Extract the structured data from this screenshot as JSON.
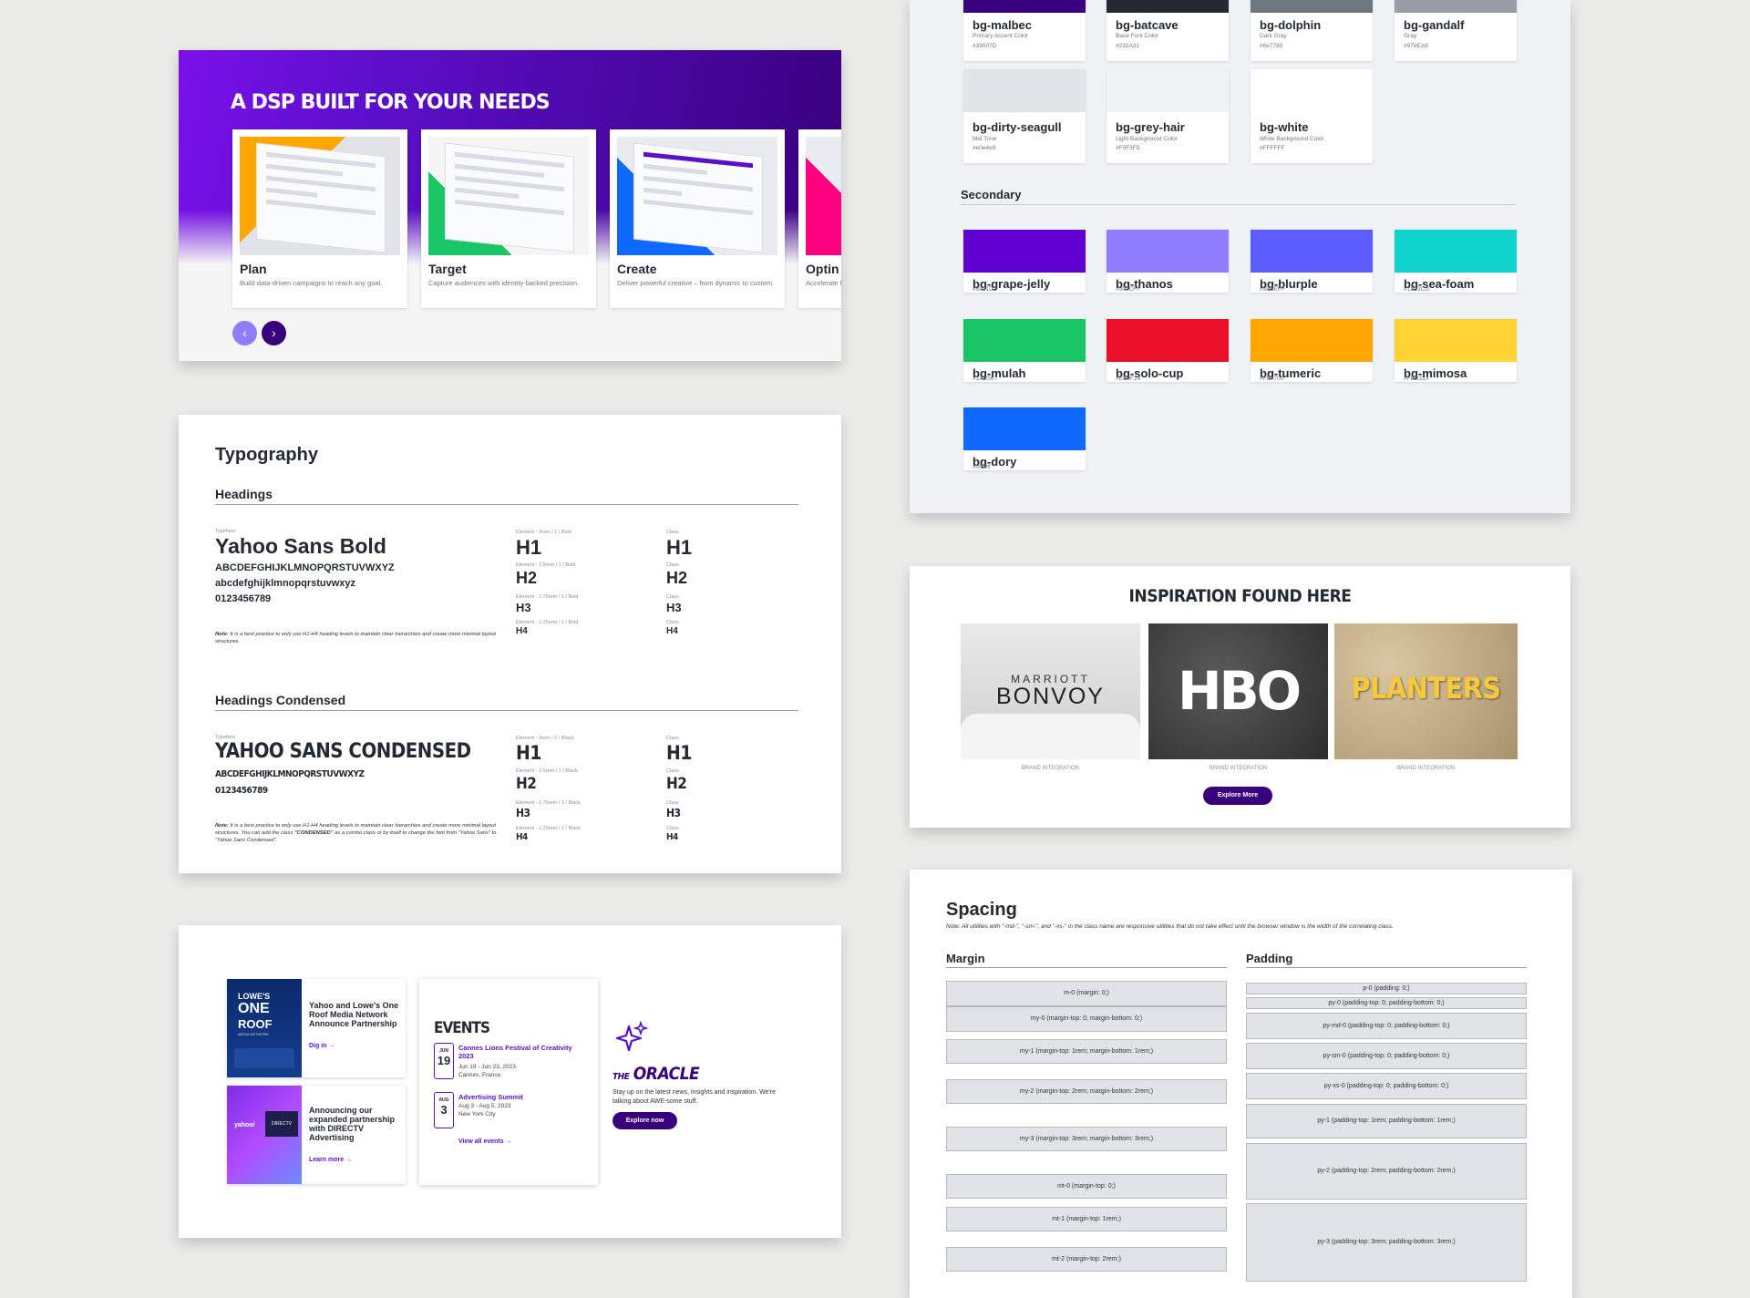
{
  "hero": {
    "title": "A DSP BUILT FOR YOUR NEEDS",
    "cards": [
      {
        "title": "Plan",
        "desc": "Build data-driven campaigns to reach any goal.",
        "accent": "#ffa700"
      },
      {
        "title": "Target",
        "desc": "Capture audiences with identity-backed precision.",
        "accent": "#1ac567"
      },
      {
        "title": "Create",
        "desc": "Deliver powerful creative – from dynamic to custom.",
        "accent": "#0f69ff"
      },
      {
        "title": "Optin",
        "desc": "Accelerate learning te",
        "accent": "#ff0080"
      }
    ],
    "prev_icon": "chevron-left-icon",
    "next_icon": "chevron-right-icon"
  },
  "typography": {
    "title": "Typography",
    "headings_label": "Headings",
    "typeface_label": "Typeface",
    "typeface_name": "Yahoo Sans Bold",
    "upper": "ABCDEFGHIJKLMNOPQRSTUVWXYZ",
    "lower": "abcdefghijklmnopqrstuvwxyz",
    "digits": "0123456789",
    "note_label": "Note:",
    "note": "It is a best practice to only use H1-H4 heading levels to maintain clear hierarchies and create more minimal layout structures.",
    "class_label": "Class",
    "elements": [
      {
        "meta": "Element - 3rem / 1 / Bold",
        "tag": "H1"
      },
      {
        "meta": "Element - 2.5rem / 1 / Bold",
        "tag": "H2"
      },
      {
        "meta": "Element - 1.75rem / 1 / Bold",
        "tag": "H3"
      },
      {
        "meta": "Element - 1.25rem / 1 / Bold",
        "tag": "H4"
      }
    ],
    "condensed_label": "Headings Condensed",
    "condensed_name": "YAHOO SANS CONDENSED",
    "condensed_upper": "ABCDEFGHIJKLMNOPQRSTUVWXYZ",
    "condensed_digits": "0123456789",
    "condensed_note_a": "It is a best practice to only use H1-H4 heading levels to maintain clear hierarchies and create more minimal layout structures. You can add the class",
    "condensed_note_class": "\"CONDENSED\"",
    "condensed_note_b": "as a combo class or by itself to change the font from \"Yahoo Sans\" to \"Yahoo Sans Condensed\".",
    "condensed_elements": [
      {
        "meta": "Element - 3rem / 1 / Black",
        "tag": "H1"
      },
      {
        "meta": "Element - 2.5rem / 1 / Black",
        "tag": "H2"
      },
      {
        "meta": "Element - 1.75rem / 1 / Black",
        "tag": "H3"
      },
      {
        "meta": "Element - 1.25rem / 1 / Black",
        "tag": "H4"
      }
    ]
  },
  "marketing": {
    "news": [
      {
        "title": "Yahoo and Lowe's One Roof Media Network Announce Partnership",
        "link": "Dig in →",
        "thumb_line1": "LOWE'S",
        "thumb_line2": "ONE",
        "thumb_line3": "ROOF",
        "thumb_line4": "MEDIA NETWORK"
      },
      {
        "title": "Announcing our expanded partnership with DIRECTV Advertising",
        "link": "Learn more →",
        "thumb_line1": "yahoo/",
        "thumb_line2": "DIRECTV"
      }
    ],
    "events": {
      "title": "EVENTS",
      "items": [
        {
          "month": "JUN",
          "day": "19",
          "name": "Cannes Lions Festival of Creativity 2023",
          "dates": "Jun 19 - Jun 23, 2023",
          "place": "Cannes, France"
        },
        {
          "month": "AUG",
          "day": "3",
          "name": "Advertising Summit",
          "dates": "Aug 3 - Aug 5, 2023",
          "place": "New York City"
        }
      ],
      "view_all": "View all events →"
    },
    "oracle": {
      "prefix": "THE",
      "name": "ORACLE",
      "desc": "Stay up on the latest news, insights and inspiration. We're talking about AWE-some stuff.",
      "button": "Explore now",
      "icon": "sparkle-icon"
    }
  },
  "colors": {
    "primary": [
      {
        "name": "bg-malbec",
        "desc": "Primary Accent Color",
        "hex": "#39007D",
        "color": "#39007d"
      },
      {
        "name": "bg-batcave",
        "desc": "Base Font Color",
        "hex": "#232A31",
        "color": "#232a31"
      },
      {
        "name": "bg-dolphin",
        "desc": "Dark Gray",
        "hex": "#6e7780",
        "color": "#6e7780"
      },
      {
        "name": "bg-gandalf",
        "desc": "Gray",
        "hex": "#979EA8",
        "color": "#979ea8"
      },
      {
        "name": "bg-dirty-seagull",
        "desc": "Mid Tone",
        "hex": "#e0e4e9",
        "color": "#e0e4e9"
      },
      {
        "name": "bg-grey-hair",
        "desc": "Light Background Color",
        "hex": "#F0F3F5",
        "color": "#f0f3f5"
      },
      {
        "name": "bg-white",
        "desc": "White Background Color",
        "hex": "#FFFFFF",
        "color": "#ffffff"
      }
    ],
    "secondary_label": "Secondary",
    "secondary": [
      {
        "name": "bg-grape-jelly",
        "hex": "#6001D2",
        "color": "#6001d2"
      },
      {
        "name": "bg-thanos",
        "hex": "#907CFF",
        "color": "#907cff"
      },
      {
        "name": "bg-blurple",
        "hex": "#5D5EFF",
        "color": "#5d5eff"
      },
      {
        "name": "bg-sea-foam",
        "hex": "#11D3CD",
        "color": "#11d3cd"
      },
      {
        "name": "bg-mulah",
        "hex": "#1AC567",
        "color": "#1ac567"
      },
      {
        "name": "bg-solo-cup",
        "hex": "#EB0F29",
        "color": "#eb0f29"
      },
      {
        "name": "bg-tumeric",
        "hex": "#FFA700",
        "color": "#ffa700"
      },
      {
        "name": "bg-mimosa",
        "hex": "#FFD333",
        "color": "#ffd333"
      },
      {
        "name": "bg-dory",
        "hex": "#0f69ff",
        "color": "#0f69ff"
      }
    ]
  },
  "inspiration": {
    "title": "INSPIRATION FOUND HERE",
    "tiles": [
      {
        "brand_top": "MARRIOTT",
        "brand": "BONVOY",
        "label": "BRAND INTEGRATION"
      },
      {
        "brand": "HBO",
        "label": "BRAND INTEGRATION"
      },
      {
        "brand": "PLANTERS",
        "label": "BRAND INTEGRATION"
      }
    ],
    "button": "Explore More"
  },
  "spacing": {
    "title": "Spacing",
    "note": "Note: All utilities with \"-md-\", \"-sm-\", and \"-xs-\" in the class name are responsive utilities that do not take effect until the browser window is the width of the correlating class.",
    "margin_label": "Margin",
    "padding_label": "Padding",
    "margin": [
      "m-0 (margin: 0;)",
      "my-0 (margin-top: 0; margin-bottom: 0;)",
      "my-1 (margin-top: 1rem; margin-bottom: 1rem;)",
      "my-2 (margin-top: 2rem; margin-bottom: 2rem;)",
      "my-3 (margin-top: 3rem; margin-bottom: 3rem;)",
      "mt-0 (margin-top: 0;)",
      "mt-1 (margin-top: 1rem;)",
      "mt-2 (margin-top: 2rem;)"
    ],
    "padding": [
      "p-0 (padding: 0;)",
      "py-0 (padding-top: 0; padding-bottom: 0;)",
      "py-md-0 (padding-top: 0; padding-bottom: 0;)",
      "py-sm-0 (padding-top: 0; padding-bottom: 0;)",
      "py-xs-0 (padding-top: 0; padding-bottom: 0;)",
      "py-1 (padding-top: 1rem; padding-bottom: 1rem;)",
      "py-2 (padding-top: 2rem; padding-bottom: 2rem;)",
      "py-3 (padding-top: 3rem; padding-bottom: 3rem;)"
    ]
  }
}
